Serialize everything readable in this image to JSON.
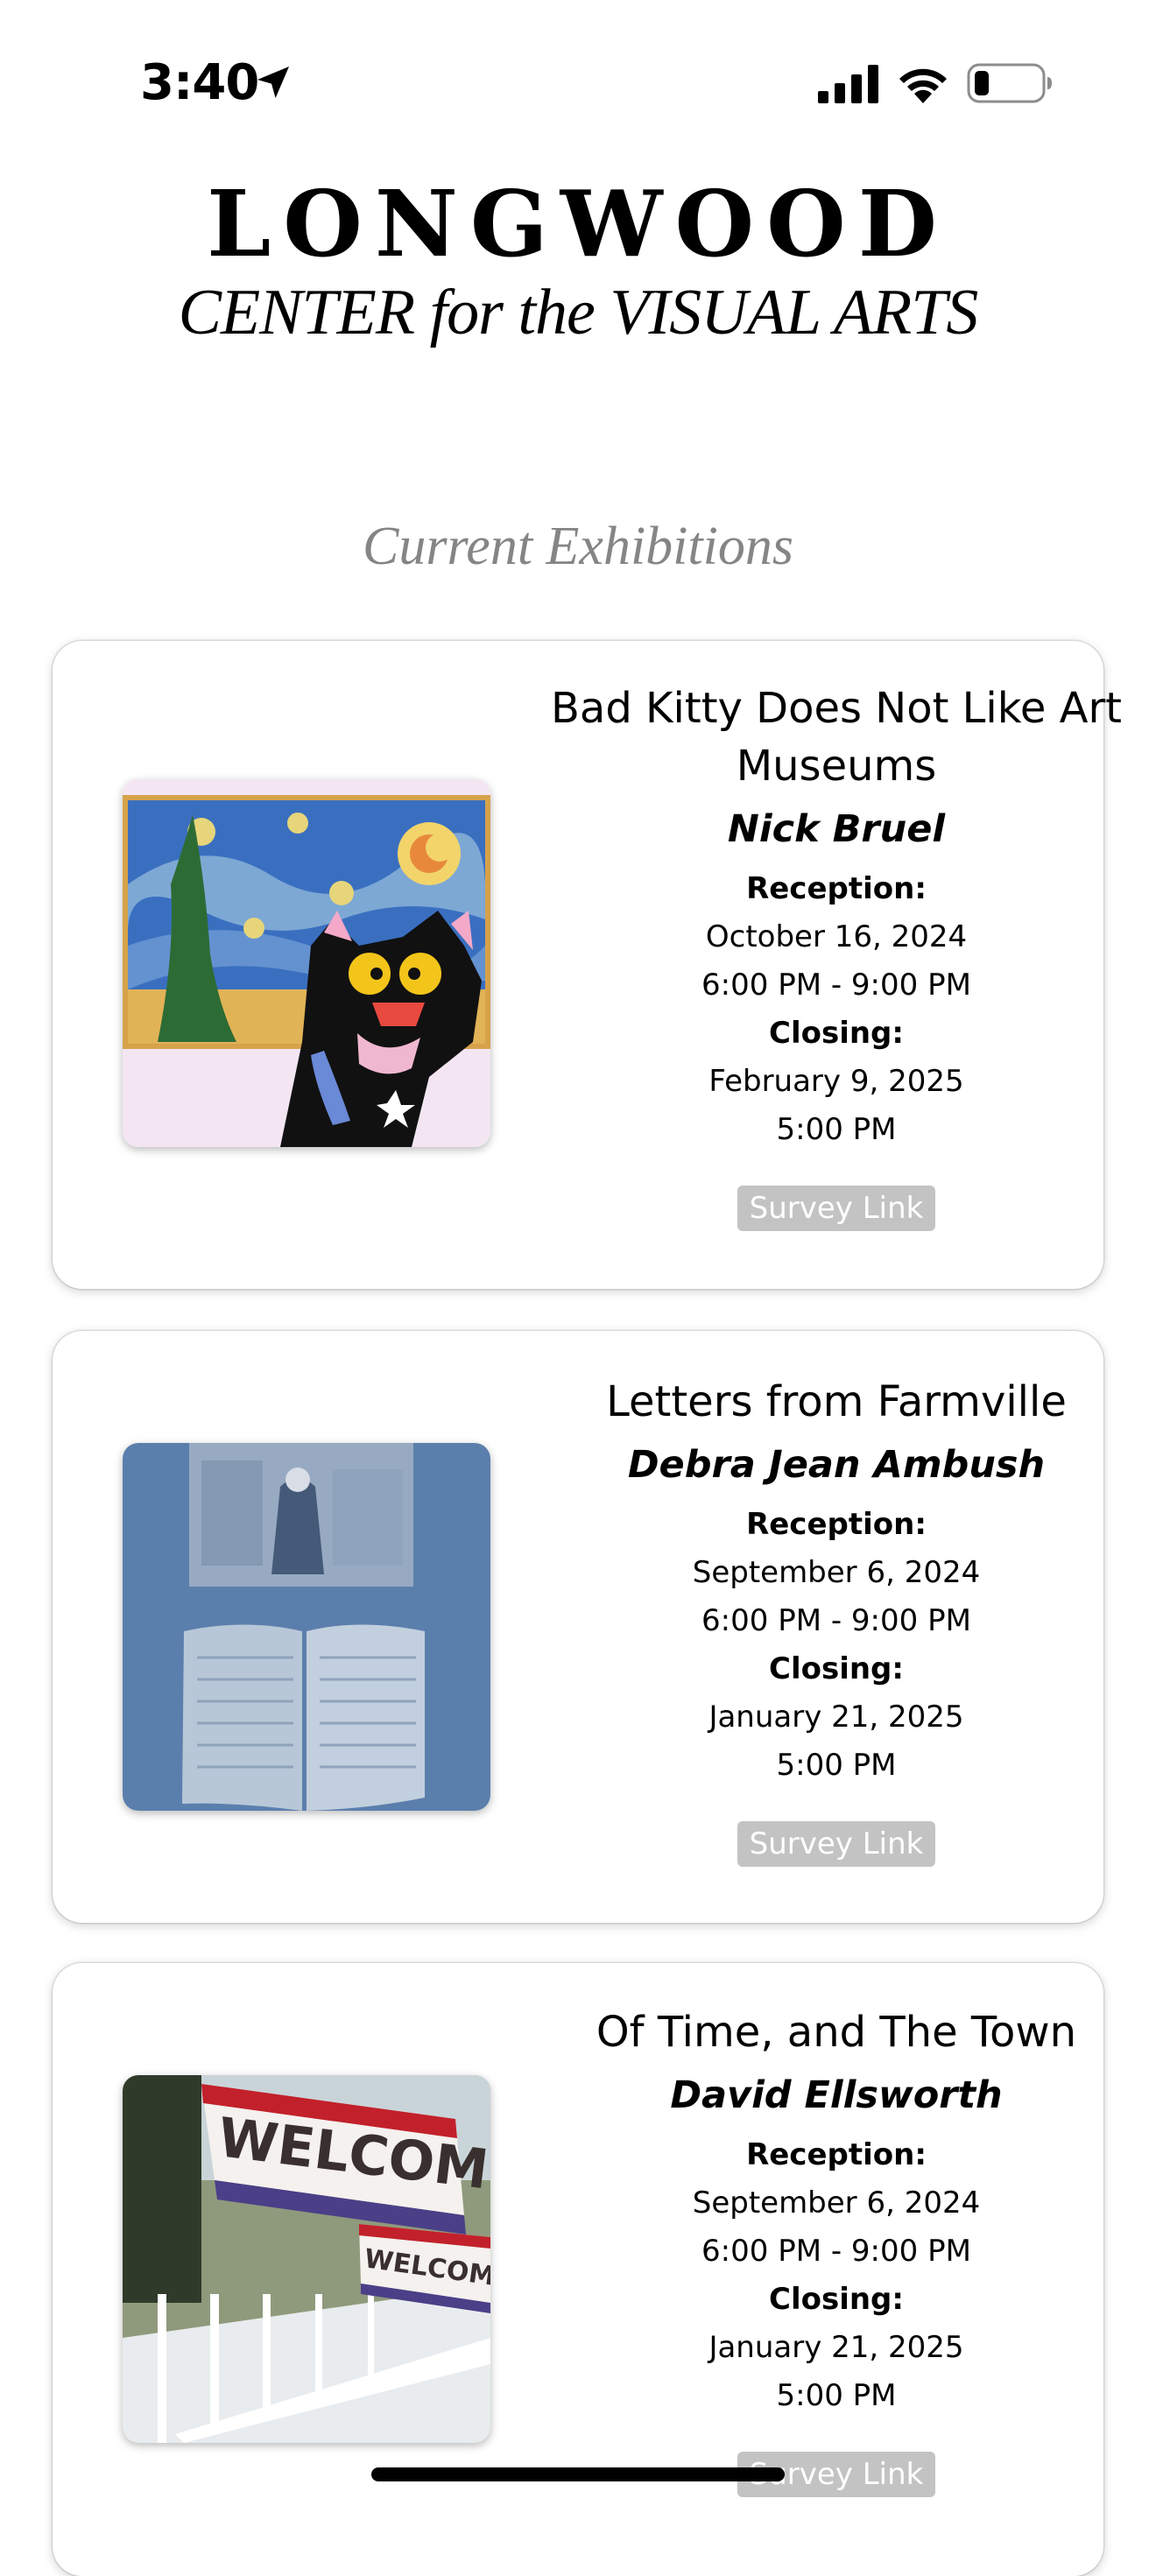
{
  "status_bar": {
    "time": "3:40",
    "icons": [
      "location-arrow-icon",
      "cellular-signal-icon",
      "wifi-icon",
      "battery-low-icon"
    ]
  },
  "header": {
    "title": "LONGWOOD",
    "subtitle": "CENTER for the VISUAL ARTS"
  },
  "section": {
    "title": "Current Exhibitions"
  },
  "exhibitions": [
    {
      "title": "Bad Kitty Does Not Like Art Museums",
      "artist": "Nick Bruel",
      "reception_label": "Reception:",
      "reception_date": "October 16, 2024",
      "reception_time": "6:00 PM - 9:00 PM",
      "closing_label": "Closing:",
      "closing_date": "February 9, 2025",
      "closing_time": "5:00 PM",
      "button_label": "Survey Link"
    },
    {
      "title": "Letters from Farmville",
      "artist": "Debra Jean Ambush",
      "reception_label": "Reception:",
      "reception_date": "September 6, 2024",
      "reception_time": "6:00 PM - 9:00 PM",
      "closing_label": "Closing:",
      "closing_date": "January 21, 2025",
      "closing_time": "5:00 PM",
      "button_label": "Survey Link"
    },
    {
      "title": "Of Time, and The Town",
      "artist": "David Ellsworth",
      "reception_label": "Reception:",
      "reception_date": "September 6, 2024",
      "reception_time": "6:00 PM - 9:00 PM",
      "closing_label": "Closing:",
      "closing_date": "January 21, 2025",
      "closing_time": "5:00 PM",
      "button_label": "Survey Link",
      "image_text": [
        "WELCOME",
        "WELCOME"
      ]
    }
  ],
  "colors": {
    "section_title": "#858585",
    "button_bg": "#c3c3c3",
    "button_text": "#ffffff"
  }
}
